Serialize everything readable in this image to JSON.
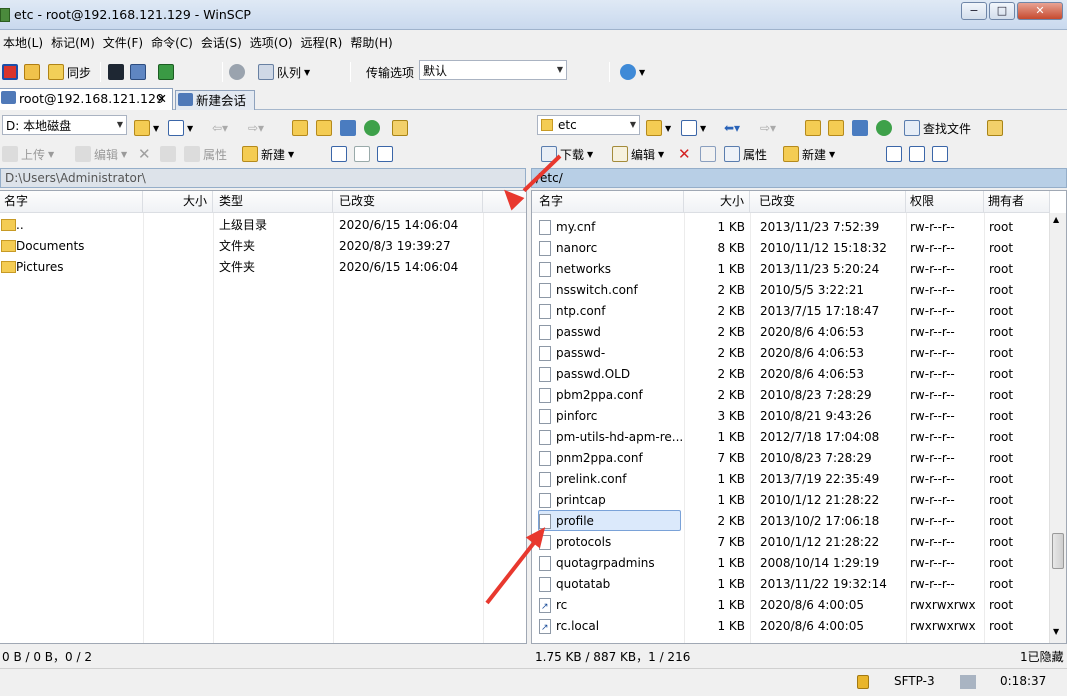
{
  "window": {
    "title": "etc - root@192.168.121.129 - WinSCP",
    "min": "−",
    "max": "□",
    "close": "✕"
  },
  "menu": [
    "本地(L)",
    "标记(M)",
    "文件(F)",
    "命令(C)",
    "会话(S)",
    "选项(O)",
    "远程(R)",
    "帮助(H)"
  ],
  "toolbar": {
    "sync": "同步",
    "queue": "队列",
    "transfer_label": "传输选项",
    "transfer_value": "默认"
  },
  "tabs": {
    "session": "root@192.168.121.129",
    "new_session": "新建会话"
  },
  "left": {
    "drive": "D: 本地磁盘",
    "upload": "上传",
    "edit": "编辑",
    "props": "属性",
    "new": "新建",
    "path": "D:\\Users\\Administrator\\",
    "columns": {
      "name": "名字",
      "size": "大小",
      "type": "类型",
      "changed": "已改变"
    },
    "files": [
      {
        "name": "..",
        "type": "上级目录",
        "changed": "2020/6/15  14:06:04",
        "icon": "parent-dir-icon"
      },
      {
        "name": "Documents",
        "type": "文件夹",
        "changed": "2020/8/3  19:39:27",
        "icon": "folder-icon"
      },
      {
        "name": "Pictures",
        "type": "文件夹",
        "changed": "2020/6/15  14:06:04",
        "icon": "folder-icon"
      }
    ],
    "status": "0 B / 0 B，0 / 2"
  },
  "right": {
    "dir": "etc",
    "download": "下载",
    "edit": "编辑",
    "props": "属性",
    "new": "新建",
    "find": "查找文件",
    "path": "/etc/",
    "columns": {
      "name": "名字",
      "size": "大小",
      "changed": "已改变",
      "rights": "权限",
      "owner": "拥有者"
    },
    "files": [
      {
        "name": "my.cnf",
        "size": "1 KB",
        "changed": "2013/11/23 7:52:39",
        "rights": "rw-r--r--",
        "owner": "root"
      },
      {
        "name": "nanorc",
        "size": "8 KB",
        "changed": "2010/11/12 15:18:32",
        "rights": "rw-r--r--",
        "owner": "root"
      },
      {
        "name": "networks",
        "size": "1 KB",
        "changed": "2013/11/23 5:20:24",
        "rights": "rw-r--r--",
        "owner": "root"
      },
      {
        "name": "nsswitch.conf",
        "size": "2 KB",
        "changed": "2010/5/5 3:22:21",
        "rights": "rw-r--r--",
        "owner": "root"
      },
      {
        "name": "ntp.conf",
        "size": "2 KB",
        "changed": "2013/7/15 17:18:47",
        "rights": "rw-r--r--",
        "owner": "root"
      },
      {
        "name": "passwd",
        "size": "2 KB",
        "changed": "2020/8/6 4:06:53",
        "rights": "rw-r--r--",
        "owner": "root"
      },
      {
        "name": "passwd-",
        "size": "2 KB",
        "changed": "2020/8/6 4:06:53",
        "rights": "rw-r--r--",
        "owner": "root"
      },
      {
        "name": "passwd.OLD",
        "size": "2 KB",
        "changed": "2020/8/6 4:06:53",
        "rights": "rw-r--r--",
        "owner": "root"
      },
      {
        "name": "pbm2ppa.conf",
        "size": "2 KB",
        "changed": "2010/8/23 7:28:29",
        "rights": "rw-r--r--",
        "owner": "root"
      },
      {
        "name": "pinforc",
        "size": "3 KB",
        "changed": "2010/8/21 9:43:26",
        "rights": "rw-r--r--",
        "owner": "root"
      },
      {
        "name": "pm-utils-hd-apm-re...",
        "size": "1 KB",
        "changed": "2012/7/18 17:04:08",
        "rights": "rw-r--r--",
        "owner": "root"
      },
      {
        "name": "pnm2ppa.conf",
        "size": "7 KB",
        "changed": "2010/8/23 7:28:29",
        "rights": "rw-r--r--",
        "owner": "root"
      },
      {
        "name": "prelink.conf",
        "size": "1 KB",
        "changed": "2013/7/19 22:35:49",
        "rights": "rw-r--r--",
        "owner": "root"
      },
      {
        "name": "printcap",
        "size": "1 KB",
        "changed": "2010/1/12 21:28:22",
        "rights": "rw-r--r--",
        "owner": "root"
      },
      {
        "name": "profile",
        "size": "2 KB",
        "changed": "2013/10/2 17:06:18",
        "rights": "rw-r--r--",
        "owner": "root",
        "selected": true
      },
      {
        "name": "protocols",
        "size": "7 KB",
        "changed": "2010/1/12 21:28:22",
        "rights": "rw-r--r--",
        "owner": "root"
      },
      {
        "name": "quotagrpadmins",
        "size": "1 KB",
        "changed": "2008/10/14 1:29:19",
        "rights": "rw-r--r--",
        "owner": "root"
      },
      {
        "name": "quotatab",
        "size": "1 KB",
        "changed": "2013/11/22 19:32:14",
        "rights": "rw-r--r--",
        "owner": "root"
      },
      {
        "name": "rc",
        "size": "1 KB",
        "changed": "2020/8/6 4:00:05",
        "rights": "rwxrwxrwx",
        "owner": "root",
        "link": true
      },
      {
        "name": "rc.local",
        "size": "1 KB",
        "changed": "2020/8/6 4:00:05",
        "rights": "rwxrwxrwx",
        "owner": "root",
        "link": true
      }
    ],
    "status": "1.75 KB / 887 KB，1 / 216",
    "hidden": "1已隐藏"
  },
  "bottom": {
    "protocol": "SFTP-3",
    "timer": "0:18:37"
  },
  "colors": {
    "accent": "#b8cfe6",
    "selection": "#dbe9fb",
    "annotation_arrow": "#e8382e"
  }
}
